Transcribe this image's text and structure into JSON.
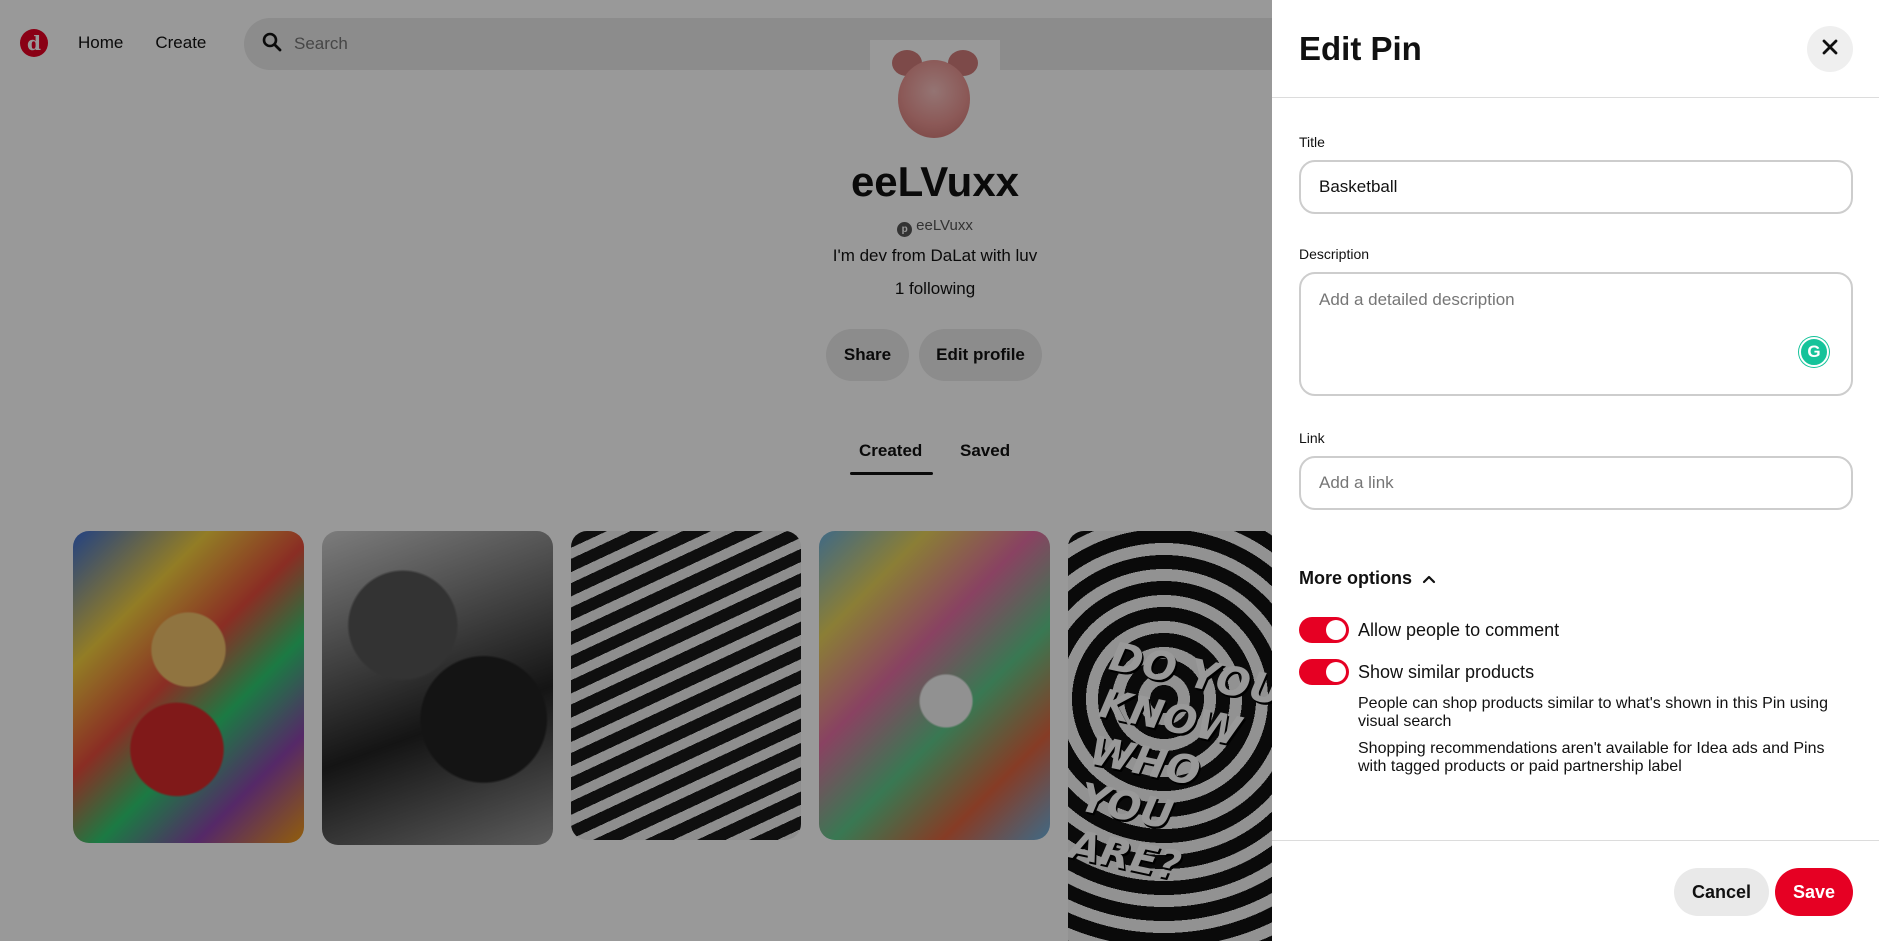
{
  "background": {
    "nav": {
      "logo": "d",
      "home_label": "Home",
      "create_label": "Create",
      "search_placeholder": "Search"
    },
    "profile": {
      "name": "eeLVuxx",
      "handle": "eeLVuxx",
      "bio": "I'm dev from DaLat with luv",
      "following": "1 following",
      "share_label": "Share",
      "edit_profile_label": "Edit profile"
    },
    "tabs": [
      {
        "label": "Created",
        "active": true
      },
      {
        "label": "Saved",
        "active": false
      }
    ],
    "pins": [
      {
        "name": "pin-popart-basketball"
      },
      {
        "name": "pin-bw-photo"
      },
      {
        "name": "pin-striped-face"
      },
      {
        "name": "pin-einstein-collage"
      },
      {
        "name": "pin-do-you-know-who-you-are"
      }
    ],
    "pin5_text": "DO YOU KNOW WHO YOU ARE?"
  },
  "panel": {
    "title": "Edit Pin",
    "fields": {
      "title_label": "Title",
      "title_value": "Basketball",
      "description_label": "Description",
      "description_value": "",
      "description_placeholder": "Add a detailed description",
      "link_label": "Link",
      "link_value": "",
      "link_placeholder": "Add a link"
    },
    "grammarly_glyph": "G",
    "more_options_label": "More options",
    "toggles": [
      {
        "label": "Allow people to comment",
        "on": true
      },
      {
        "label": "Show similar products",
        "on": true
      }
    ],
    "notes": [
      "People can shop products similar to what's shown in this Pin using visual search",
      "Shopping recommendations aren't available for Idea ads and Pins with tagged products or paid partnership label"
    ],
    "cancel_label": "Cancel",
    "save_label": "Save"
  },
  "colors": {
    "brand": "#e60023",
    "overlay": "rgba(0,0,0,0.4)",
    "grammarly": "#15c39a"
  }
}
